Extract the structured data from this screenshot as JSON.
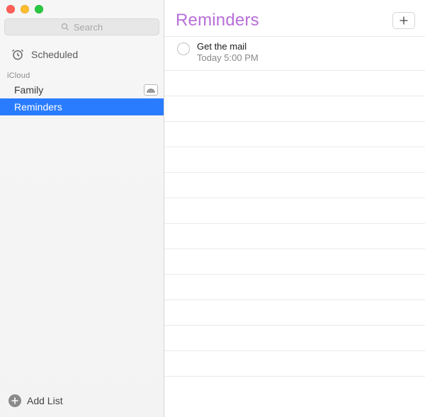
{
  "app_title": "Reminders",
  "search": {
    "placeholder": "Search"
  },
  "sidebar": {
    "scheduled_label": "Scheduled",
    "section_label": "iCloud",
    "lists": [
      {
        "name": "Family",
        "shared": true,
        "selected": false
      },
      {
        "name": "Reminders",
        "shared": false,
        "selected": true
      }
    ],
    "add_list_label": "Add List"
  },
  "main": {
    "title": "Reminders",
    "add_button_label": "+",
    "reminders": [
      {
        "title": "Get the mail",
        "due": "Today 5:00 PM"
      }
    ],
    "empty_rows": 12
  },
  "colors": {
    "accent": "#b86ed8",
    "selection": "#2a7cff"
  }
}
